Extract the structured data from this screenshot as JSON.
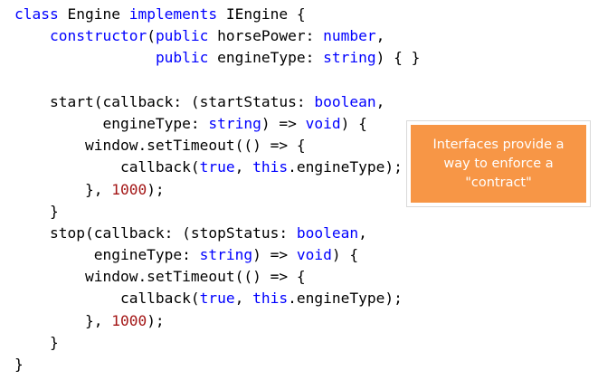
{
  "code": {
    "lines": [
      [
        [
          "kw",
          "class"
        ],
        [
          "pl",
          " Engine "
        ],
        [
          "kw",
          "implements"
        ],
        [
          "pl",
          " IEngine {"
        ]
      ],
      [
        [
          "pl",
          "    "
        ],
        [
          "kw",
          "constructor"
        ],
        [
          "pl",
          "("
        ],
        [
          "kw",
          "public"
        ],
        [
          "pl",
          " horsePower: "
        ],
        [
          "kw",
          "number"
        ],
        [
          "pl",
          ","
        ]
      ],
      [
        [
          "pl",
          "                "
        ],
        [
          "kw",
          "public"
        ],
        [
          "pl",
          " engineType: "
        ],
        [
          "kw",
          "string"
        ],
        [
          "pl",
          ") { }"
        ]
      ],
      [],
      [
        [
          "pl",
          "    start(callback: (startStatus: "
        ],
        [
          "kw",
          "boolean"
        ],
        [
          "pl",
          ","
        ]
      ],
      [
        [
          "pl",
          "          engineType: "
        ],
        [
          "kw",
          "string"
        ],
        [
          "pl",
          ") => "
        ],
        [
          "kw",
          "void"
        ],
        [
          "pl",
          ") {"
        ]
      ],
      [
        [
          "pl",
          "        window.setTimeout(() => {"
        ]
      ],
      [
        [
          "pl",
          "            callback("
        ],
        [
          "kw",
          "true"
        ],
        [
          "pl",
          ", "
        ],
        [
          "kw",
          "this"
        ],
        [
          "pl",
          ".engineType);"
        ]
      ],
      [
        [
          "pl",
          "        }, "
        ],
        [
          "num",
          "1000"
        ],
        [
          "pl",
          ");"
        ]
      ],
      [
        [
          "pl",
          "    }"
        ]
      ],
      [
        [
          "pl",
          "    stop(callback: (stopStatus: "
        ],
        [
          "kw",
          "boolean"
        ],
        [
          "pl",
          ","
        ]
      ],
      [
        [
          "pl",
          "         engineType: "
        ],
        [
          "kw",
          "string"
        ],
        [
          "pl",
          ") => "
        ],
        [
          "kw",
          "void"
        ],
        [
          "pl",
          ") {"
        ]
      ],
      [
        [
          "pl",
          "        window.setTimeout(() => {"
        ]
      ],
      [
        [
          "pl",
          "            callback("
        ],
        [
          "kw",
          "true"
        ],
        [
          "pl",
          ", "
        ],
        [
          "kw",
          "this"
        ],
        [
          "pl",
          ".engineType);"
        ]
      ],
      [
        [
          "pl",
          "        }, "
        ],
        [
          "num",
          "1000"
        ],
        [
          "pl",
          ");"
        ]
      ],
      [
        [
          "pl",
          "    }"
        ]
      ],
      [
        [
          "pl",
          "}"
        ]
      ]
    ]
  },
  "callout": {
    "lines": [
      "Interfaces provide a",
      "way to enforce a",
      "\"contract\""
    ]
  },
  "colors": {
    "keyword": "#0000ff",
    "number": "#a31515",
    "plain": "#000000",
    "callout_fill": "#f79646",
    "callout_text": "#ffffff"
  }
}
